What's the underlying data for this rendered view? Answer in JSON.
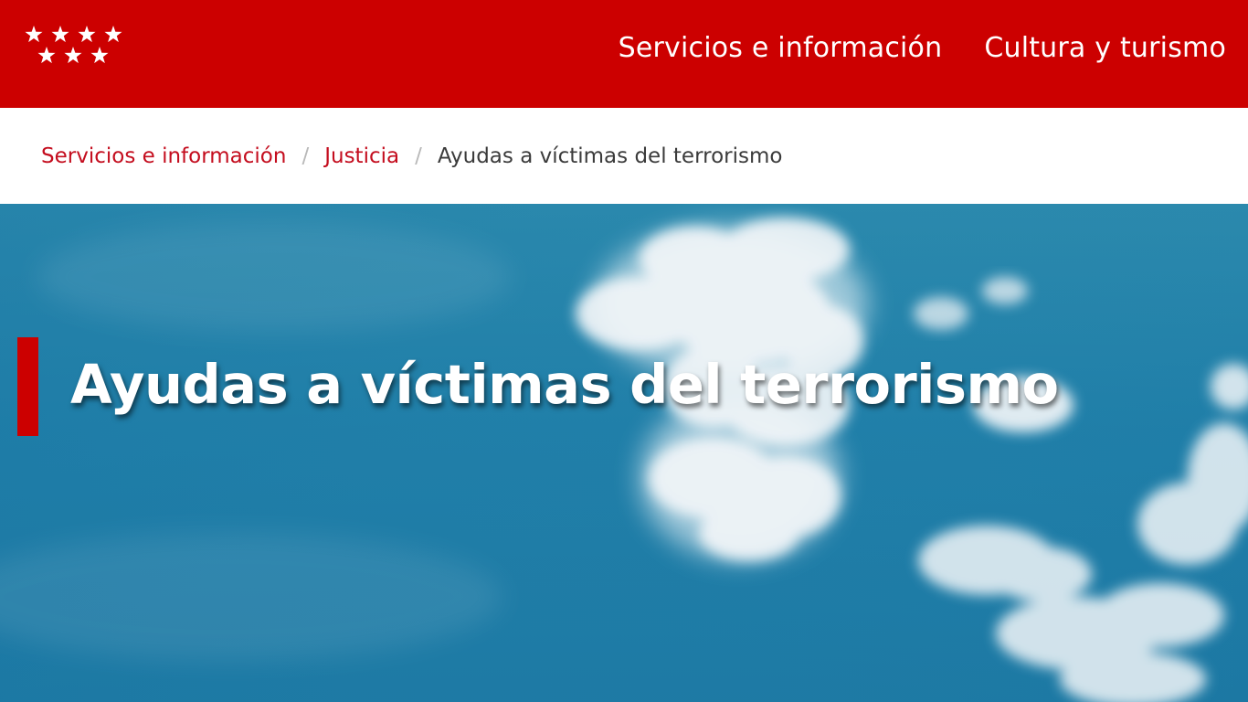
{
  "header": {
    "logo_icon": "comunidad-madrid-stars-logo",
    "nav": [
      {
        "label": "Servicios e información"
      },
      {
        "label": "Cultura y turismo"
      }
    ]
  },
  "breadcrumb": {
    "items": [
      {
        "label": "Servicios e información"
      },
      {
        "label": "Justicia"
      }
    ],
    "separator": "/",
    "current": "Ayudas a víctimas del terrorismo"
  },
  "hero": {
    "title": "Ayudas a víctimas del terrorismo",
    "background": "blue-sky-with-clouds"
  },
  "colors": {
    "brand_red": "#cc0000",
    "link_red": "#c40d1e",
    "sky_blue": "#1f7ea8"
  }
}
